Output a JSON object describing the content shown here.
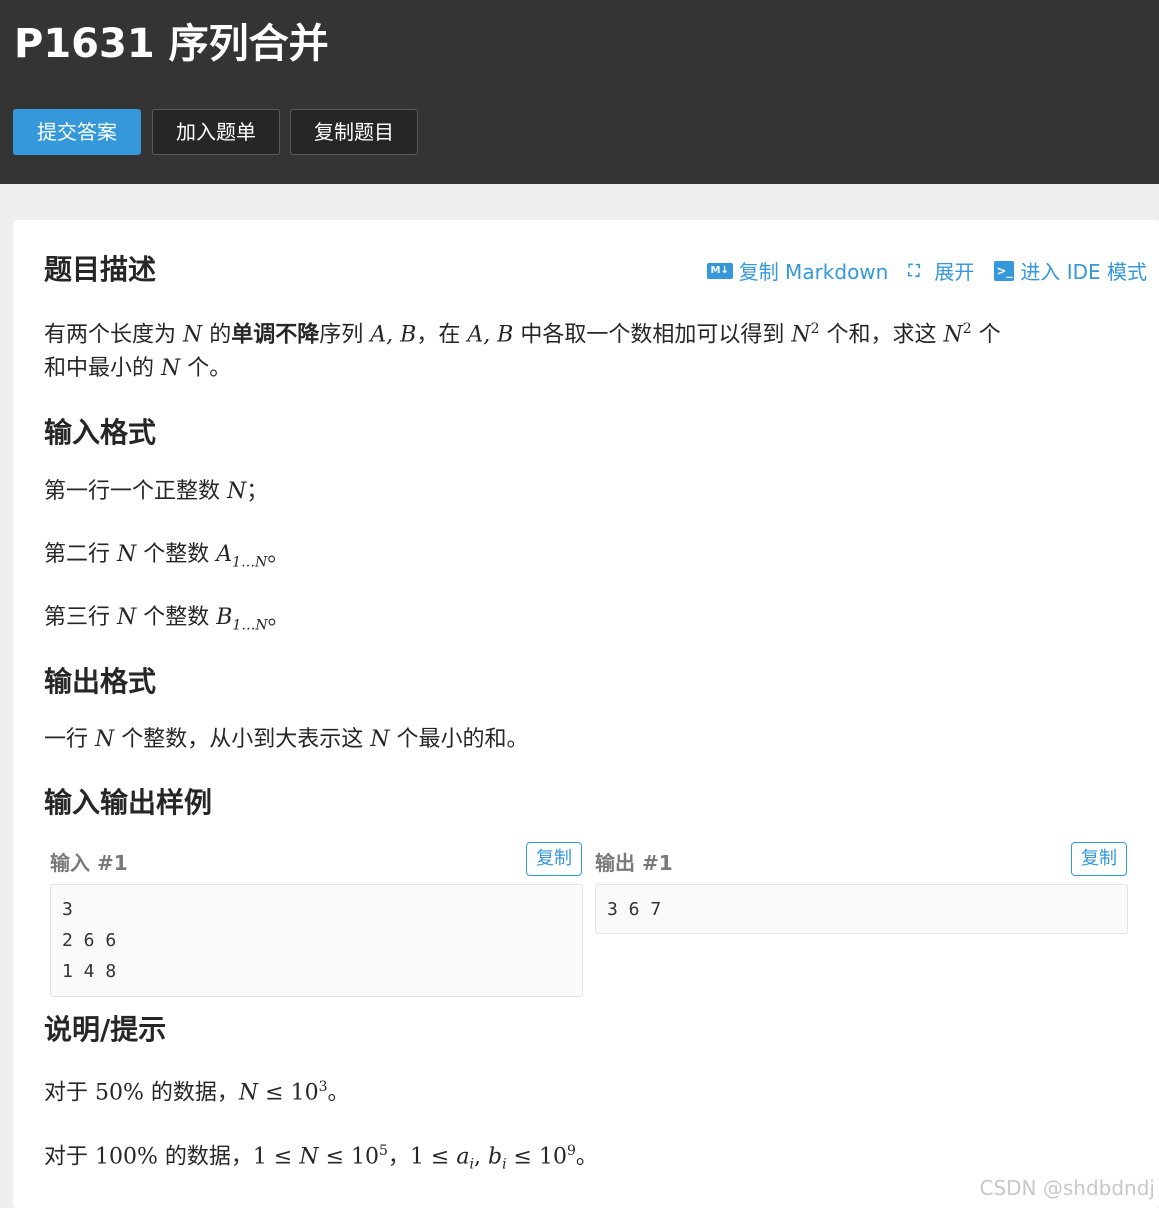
{
  "header": {
    "title": "P1631 序列合并",
    "buttons": {
      "submit": "提交答案",
      "add_list": "加入题单",
      "copy_problem": "复制题目"
    }
  },
  "toolbar": {
    "copy_markdown": "复制 Markdown",
    "expand": "展开",
    "ide_mode": "进入 IDE 模式",
    "md_icon_text": "M↓"
  },
  "description": {
    "heading": "题目描述",
    "t1": "有两个长度为 ",
    "v1": "N",
    "t2": " 的",
    "bold": "单调不降",
    "t3": "序列 ",
    "v2": "A, B",
    "t4": "，在 ",
    "v3": "A, B",
    "t5": " 中各取一个数相加可以得到 ",
    "v4": "N",
    "sup1": "2",
    "t6": " 个和，求这 ",
    "v5": "N",
    "sup2": "2",
    "t7": " 个",
    "l2_t1": "和中最小的 ",
    "l2_v1": "N",
    "l2_t2": " 个。"
  },
  "input_format": {
    "heading": "输入格式",
    "line1_text": "第一行一个正整数 ",
    "line1_var": "N",
    "line1_end": "；",
    "line2_text": "第二行 ",
    "line2_var": "N",
    "line2_mid": " 个整数 ",
    "line2_var2": "A",
    "line2_sub": "1…N",
    "line2_end": "。",
    "line3_text": "第三行 ",
    "line3_var": "N",
    "line3_mid": " 个整数 ",
    "line3_var2": "B",
    "line3_sub": "1…N",
    "line3_end": "。"
  },
  "output_format": {
    "heading": "输出格式",
    "t1": "一行 ",
    "v1": "N",
    "t2": " 个整数，从小到大表示这 ",
    "v2": "N",
    "t3": " 个最小的和。"
  },
  "samples": {
    "heading": "输入输出样例",
    "input_label": "输入 #1",
    "output_label": "输出 #1",
    "copy_label": "复制",
    "input_text": "3\n2 6 6\n1 4 8",
    "output_text": "3 6 7"
  },
  "hint": {
    "heading": "说明/提示",
    "l1_t1": "对于 ",
    "l1_n1": "50%",
    "l1_t2": " 的数据，",
    "l1_v1": "N",
    "l1_op": " ≤ ",
    "l1_n2": "10",
    "l1_sup": "3",
    "l1_end": "。",
    "l2_t1": "对于 ",
    "l2_n1": "100%",
    "l2_t2": " 的数据，",
    "l2_n2": "1",
    "l2_op1": " ≤ ",
    "l2_v1": "N",
    "l2_op2": " ≤ ",
    "l2_n3": "10",
    "l2_sup1": "5",
    "l2_t3": "，",
    "l2_n4": "1",
    "l2_op3": " ≤ ",
    "l2_v2": "a",
    "l2_sub1": "i",
    "l2_comma": ", ",
    "l2_v3": "b",
    "l2_sub2": "i",
    "l2_op4": " ≤ ",
    "l2_n5": "10",
    "l2_sup2": "9",
    "l2_end": "。"
  },
  "watermark": "CSDN @shdbdndj",
  "colors": {
    "header_bg": "#343434",
    "accent": "#3498db",
    "page_bg": "#efefef"
  }
}
